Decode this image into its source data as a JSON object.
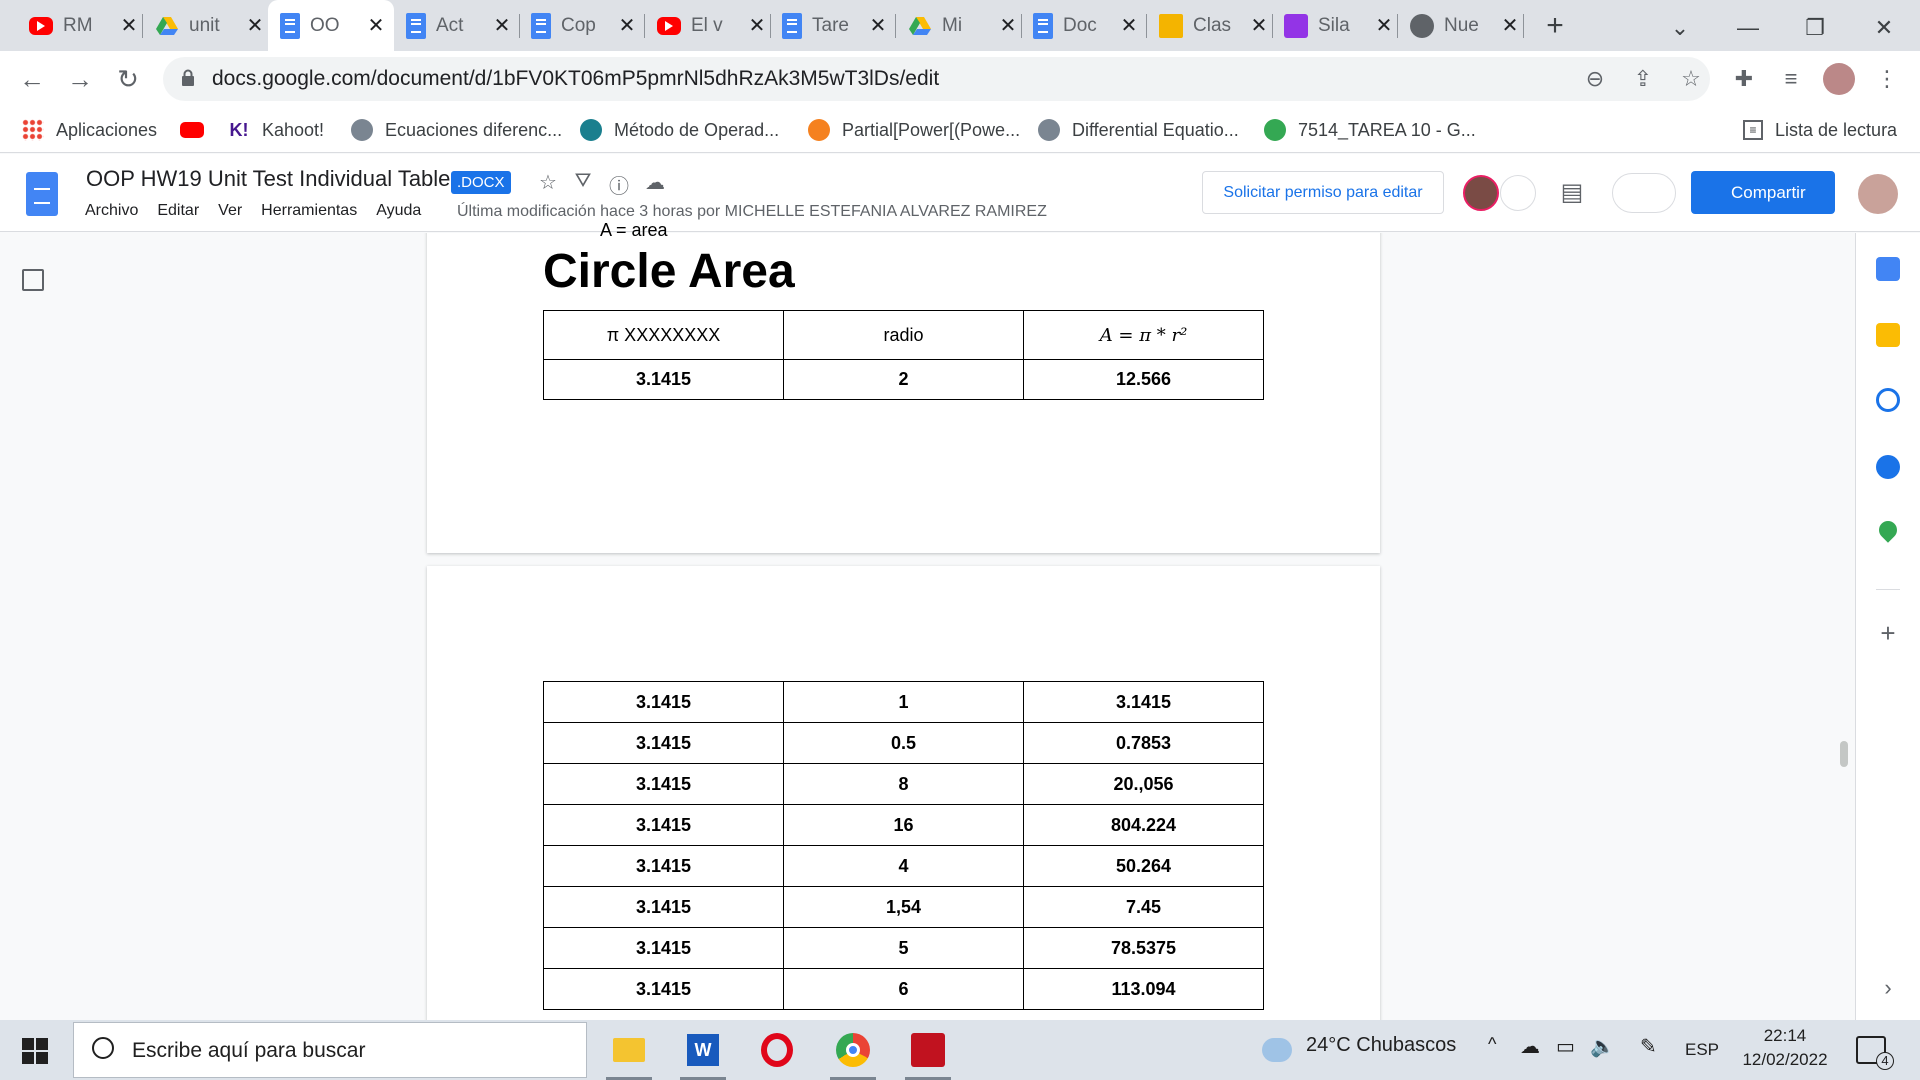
{
  "browser": {
    "tabs": [
      {
        "title": "RM",
        "icon": "youtube-icon"
      },
      {
        "title": "unit",
        "icon": "drive-icon"
      },
      {
        "title": "OO",
        "icon": "docs-icon",
        "active": true
      },
      {
        "title": "Act",
        "icon": "docs-icon"
      },
      {
        "title": "Cop",
        "icon": "docs-icon"
      },
      {
        "title": "El v",
        "icon": "youtube-icon"
      },
      {
        "title": "Tare",
        "icon": "docs-icon"
      },
      {
        "title": "Mi",
        "icon": "drive-icon"
      },
      {
        "title": "Doc",
        "icon": "docs-icon"
      },
      {
        "title": "Clas",
        "icon": "classroom-icon"
      },
      {
        "title": "Sila",
        "icon": "classroom-purple-icon"
      },
      {
        "title": "Nue",
        "icon": "chrome-icon"
      }
    ],
    "tab_close": "✕",
    "new_tab": "+",
    "url": "docs.google.com/document/d/1bFV0KT06mP5pmrNl5dhRzAk3M5wT3lDs/edit",
    "bookmarks": [
      {
        "label": "Aplicaciones",
        "icon": "apps-grid-icon"
      },
      {
        "label": "",
        "icon": "youtube-icon"
      },
      {
        "label": "Kahoot!",
        "icon": "kahoot-icon"
      },
      {
        "label": "Ecuaciones diferenc...",
        "icon": "wolfram-icon"
      },
      {
        "label": "Método de Operad...",
        "icon": "s-logo-icon"
      },
      {
        "label": "Partial[Power[(Powe...",
        "icon": "wolfram-star-icon"
      },
      {
        "label": "Differential Equatio...",
        "icon": "wolfram-icon"
      },
      {
        "label": "7514_TAREA 10 - G...",
        "icon": "drive-icon"
      }
    ],
    "reading_list": "Lista de lectura"
  },
  "doc": {
    "title": "OOP HW19 Unit Test Individual Table",
    "badge": ".DOCX",
    "menus": [
      "Archivo",
      "Editar",
      "Ver",
      "Herramientas",
      "Ayuda"
    ],
    "last_modified": "Última modificación hace 3 horas por MICHELLE ESTEFANIA ALVAREZ RAMIREZ",
    "request_edit": "Solicitar permiso para editar",
    "share": "Compartir"
  },
  "content": {
    "cut_text": "A = area",
    "heading": "Circle Area",
    "table1": {
      "headers": [
        "π XXXXXXXX",
        "radio",
        "A = π * r²"
      ],
      "row": [
        "3.1415",
        "2",
        "12.566"
      ]
    },
    "table2": [
      [
        "3.1415",
        "1",
        "3.1415"
      ],
      [
        "3.1415",
        "0.5",
        "0.7853"
      ],
      [
        "3.1415",
        "8",
        "20.,056"
      ],
      [
        "3.1415",
        "16",
        "804.224"
      ],
      [
        "3.1415",
        "4",
        "50.264"
      ],
      [
        "3.1415",
        "1,54",
        "7.45"
      ],
      [
        "3.1415",
        "5",
        "78.5375"
      ],
      [
        "3.1415",
        "6",
        "113.094"
      ]
    ]
  },
  "taskbar": {
    "search_placeholder": "Escribe aquí para buscar",
    "weather": "24°C  Chubascos",
    "language": "ESP",
    "time": "22:14",
    "date": "12/02/2022",
    "notifications": "4"
  }
}
